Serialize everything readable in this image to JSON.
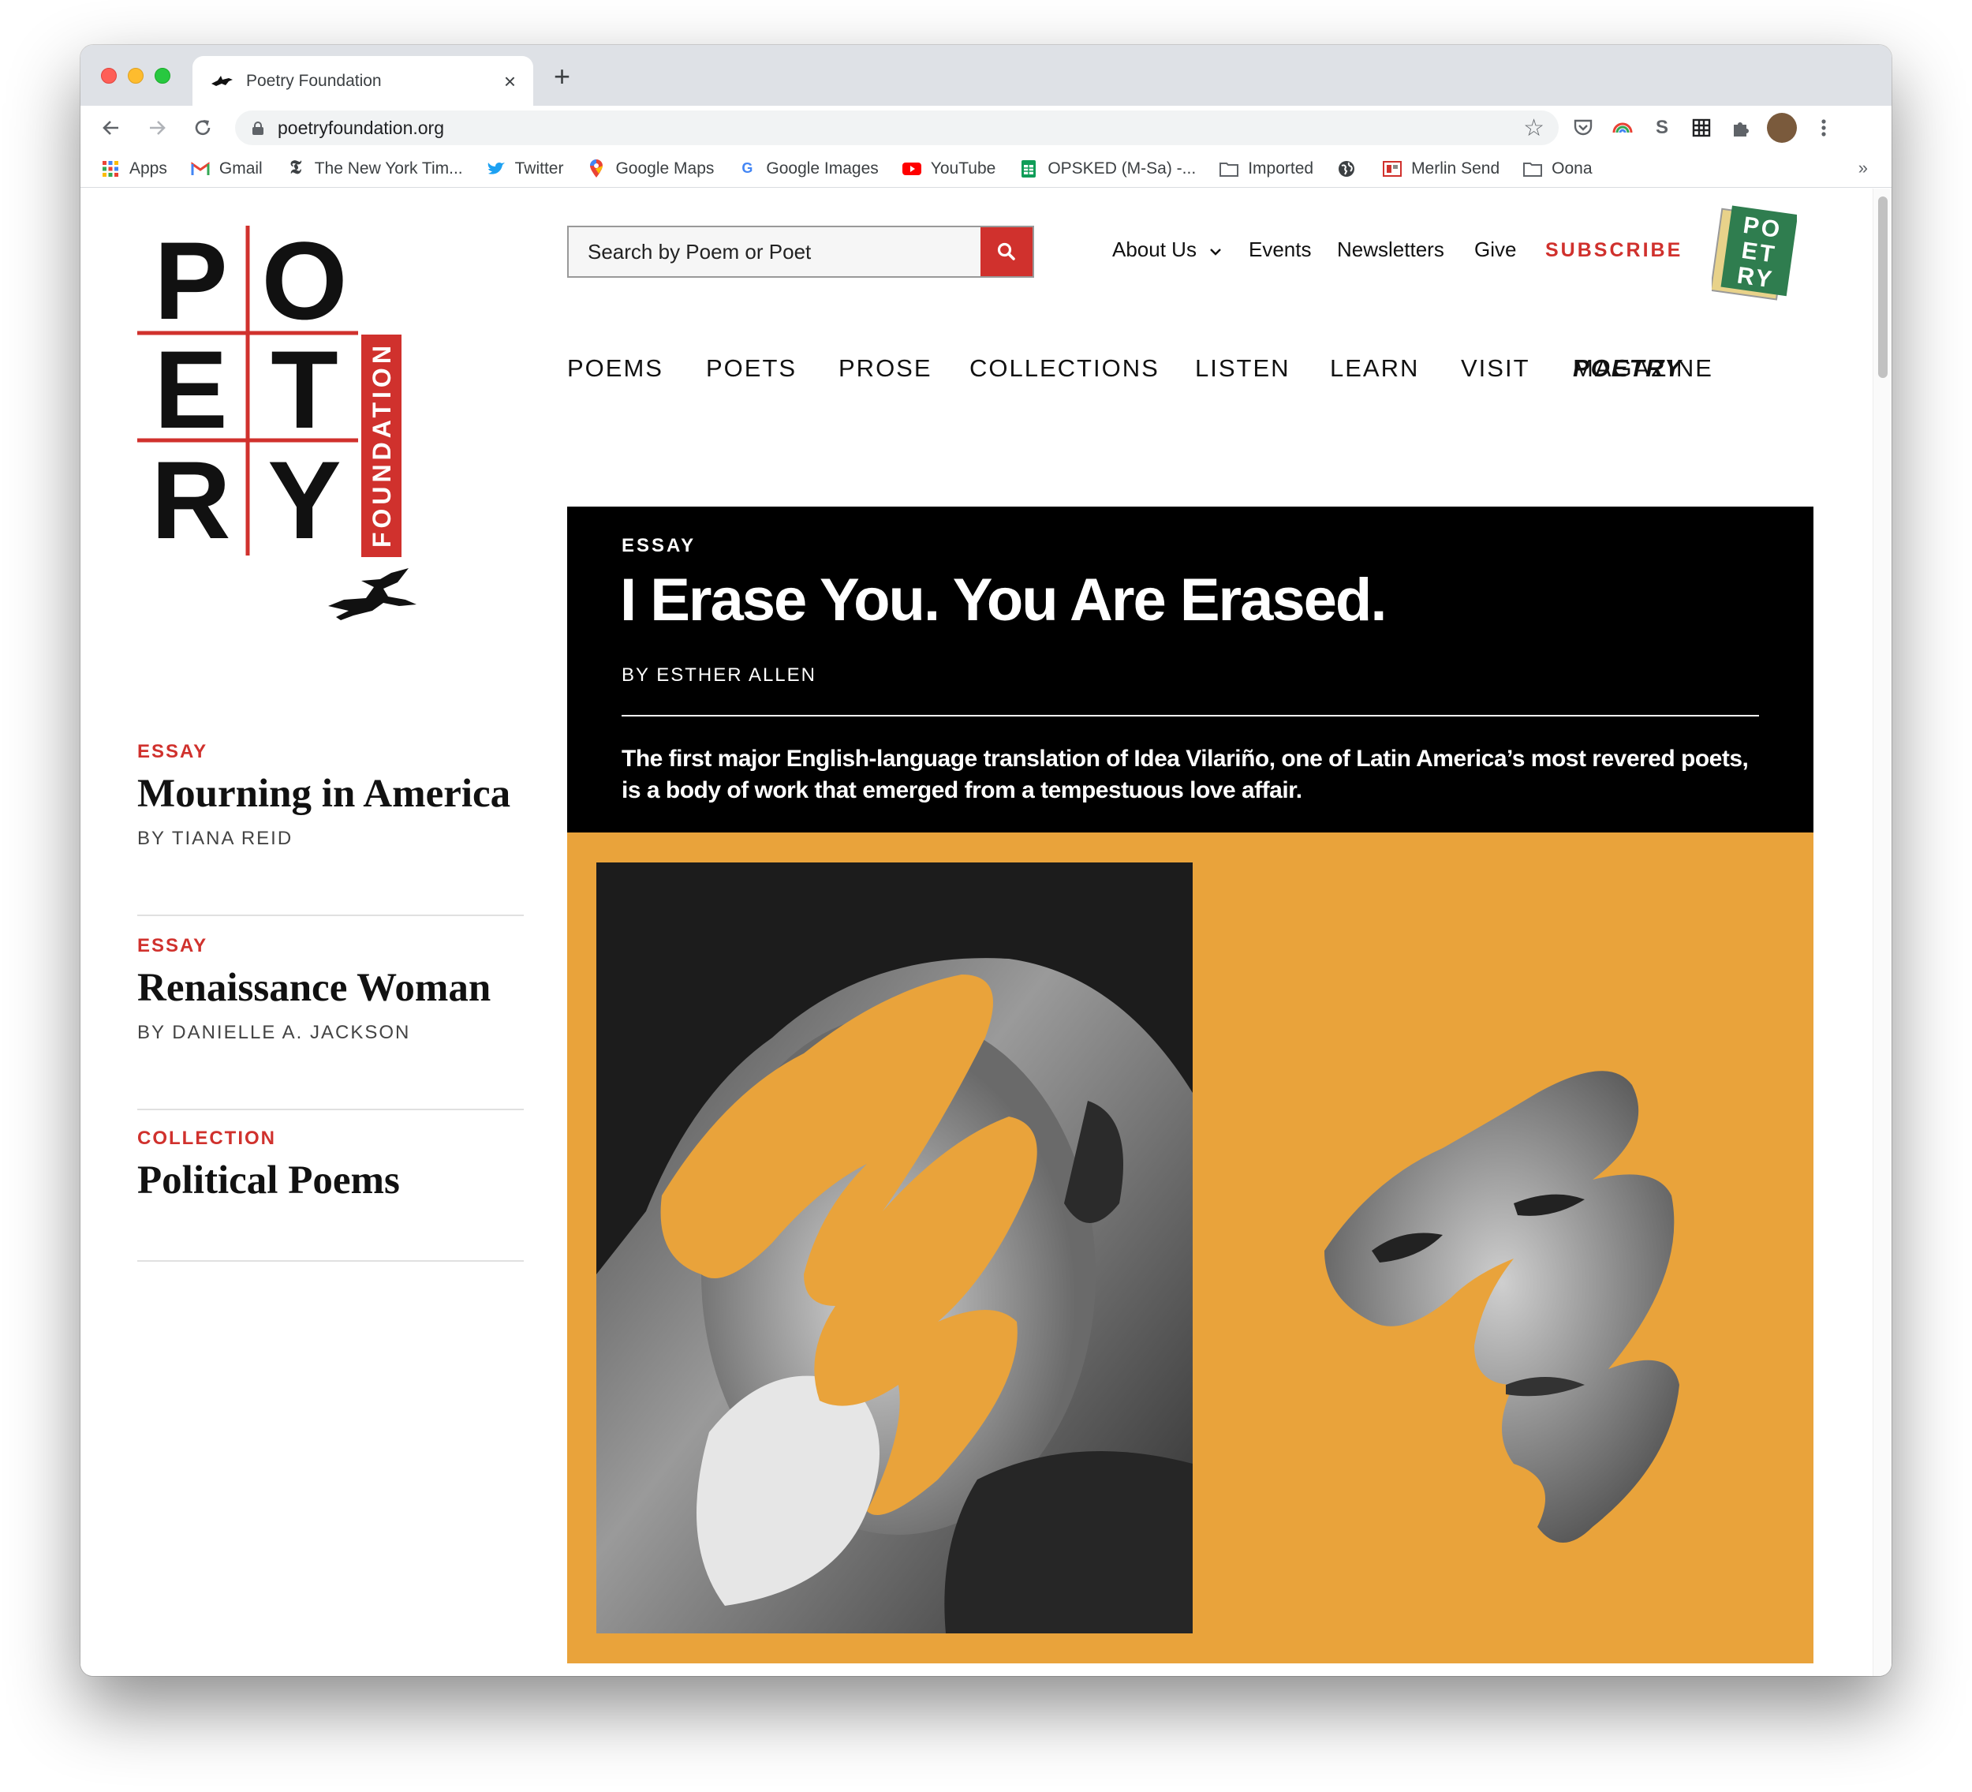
{
  "browser": {
    "tab_title": "Poetry Foundation",
    "tab_close": "×",
    "new_tab": "+",
    "url": "poetryfoundation.org",
    "bookmarks": [
      {
        "label": "Apps",
        "icon": "apps-grid-icon"
      },
      {
        "label": "Gmail",
        "icon": "gmail-icon"
      },
      {
        "label": "The New York Tim...",
        "icon": "nyt-icon"
      },
      {
        "label": "Twitter",
        "icon": "twitter-icon"
      },
      {
        "label": "Google Maps",
        "icon": "google-maps-icon"
      },
      {
        "label": "Google Images",
        "icon": "google-icon"
      },
      {
        "label": "YouTube",
        "icon": "youtube-icon"
      },
      {
        "label": "OPSKED (M-Sa) -...",
        "icon": "sheets-icon"
      },
      {
        "label": "Imported",
        "icon": "folder-icon"
      },
      {
        "label": "",
        "icon": "globe-icon"
      },
      {
        "label": "Merlin Send",
        "icon": "merlin-icon"
      },
      {
        "label": "Oona",
        "icon": "folder-icon"
      }
    ],
    "bookmarks_more": "»"
  },
  "header": {
    "logo": {
      "letters": [
        "P",
        "O",
        "E",
        "T",
        "R",
        "Y"
      ],
      "side": "FOUNDATION"
    },
    "search_placeholder": "Search by Poem or Poet",
    "util_nav": [
      "About Us",
      "Events",
      "Newsletters",
      "Give"
    ],
    "subscribe": "SUBSCRIBE",
    "badge_letters": [
      "PO",
      "ET",
      "RY"
    ]
  },
  "main_nav": [
    "POEMS",
    "POETS",
    "PROSE",
    "COLLECTIONS",
    "LISTEN",
    "LEARN",
    "VISIT"
  ],
  "main_nav_magazine": {
    "italic": "POETRY",
    "rest": " MAGAZINE"
  },
  "sidebar": [
    {
      "category": "ESSAY",
      "title": "Mourning in America",
      "byline": "BY TIANA REID"
    },
    {
      "category": "ESSAY",
      "title": "Renaissance Woman",
      "byline": "BY DANIELLE A. JACKSON"
    },
    {
      "category": "COLLECTION",
      "title": "Political Poems",
      "byline": ""
    }
  ],
  "hero": {
    "category": "ESSAY",
    "title": "I Erase You. You Are Erased.",
    "byline": "BY ESTHER ALLEN",
    "dek": "The first major English-language translation of Idea Vilariño, one of Latin America’s most revered poets, is a body of work that emerged from a tempestuous love affair.",
    "image_bg": "#e9a33b"
  },
  "colors": {
    "accent_red": "#d0312d",
    "hero_black": "#000000",
    "hero_orange": "#e9a33b"
  }
}
